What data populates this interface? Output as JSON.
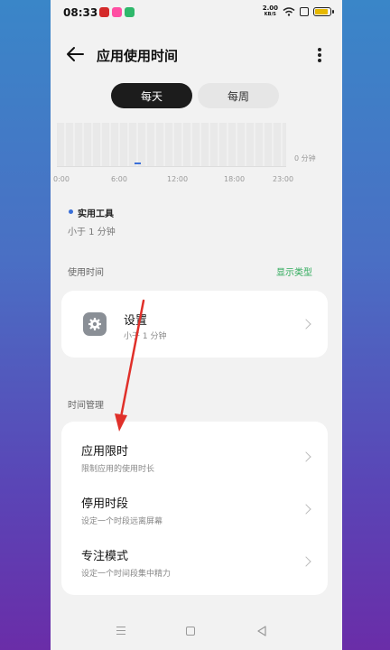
{
  "status_bar": {
    "time": "08:33",
    "net_rate_value": "2.00",
    "net_rate_unit": "KB/S"
  },
  "header": {
    "title": "应用使用时间"
  },
  "tabs": [
    {
      "label": "每天",
      "active": true
    },
    {
      "label": "每周",
      "active": false
    }
  ],
  "chart_data": {
    "type": "bar",
    "x_tick_labels": [
      "0:00",
      "6:00",
      "12:00",
      "18:00",
      "23:00"
    ],
    "y_label": "0 分钟",
    "series": [
      {
        "name": "实用工具",
        "color": "#3a6fd8"
      }
    ]
  },
  "summary": {
    "category": "实用工具",
    "value": "小于 1 分钟"
  },
  "usage_section": {
    "label": "使用时间",
    "display_type": "显示类型"
  },
  "apps": [
    {
      "name": "设置",
      "usage": "小于 1 分钟",
      "icon": "gear-icon"
    }
  ],
  "management": {
    "label": "时间管理",
    "items": [
      {
        "title": "应用限时",
        "subtitle": "限制应用的使用时长"
      },
      {
        "title": "停用时段",
        "subtitle": "设定一个时段远离屏幕"
      },
      {
        "title": "专注模式",
        "subtitle": "设定一个时间段集中精力"
      }
    ]
  },
  "colors": {
    "accent_green": "#2eaa5a",
    "chart_blue": "#3a6fd8",
    "annotation_red": "#e0302a"
  }
}
